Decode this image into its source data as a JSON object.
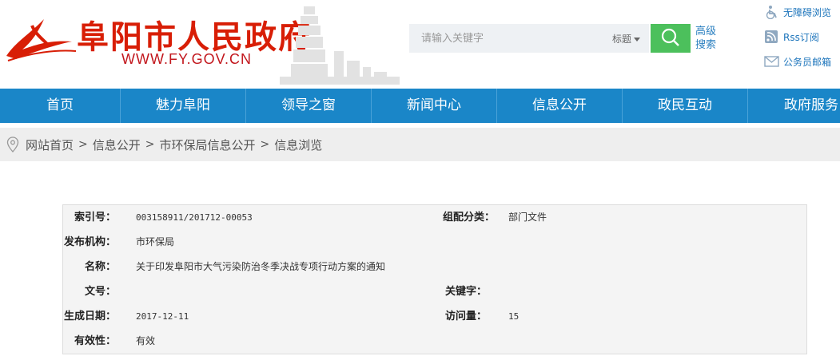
{
  "header": {
    "site_title": "阜阳市人民政府",
    "site_url": "WWW.FY.GOV.CN",
    "search": {
      "placeholder": "请输入关键字",
      "scope_selected": "标题",
      "advanced_label": "高级搜索"
    },
    "quick_links": [
      {
        "label": "无障碍浏览",
        "icon": "accessibility-icon"
      },
      {
        "label": "Rss订阅",
        "icon": "rss-icon"
      },
      {
        "label": "公务员邮箱",
        "icon": "mail-icon"
      }
    ]
  },
  "nav": {
    "items": [
      "首页",
      "魅力阜阳",
      "领导之窗",
      "新闻中心",
      "信息公开",
      "政民互动",
      "政府服务"
    ]
  },
  "breadcrumb": {
    "items": [
      "网站首页",
      "信息公开",
      "市环保局信息公开",
      "信息浏览"
    ],
    "separator": ">"
  },
  "info": {
    "index_label": "索引号：",
    "index_value": "003158911/201712-00053",
    "category_label": "组配分类：",
    "category_value": "部门文件",
    "publisher_label": "发布机构：",
    "publisher_value": "市环保局",
    "name_label": "名称：",
    "name_value": "关于印发阜阳市大气污染防治冬季决战专项行动方案的通知",
    "docno_label": "文号：",
    "docno_value": "",
    "keyword_label": "关键字：",
    "keyword_value": "",
    "date_label": "生成日期：",
    "date_value": "2017-12-11",
    "visits_label": "访问量：",
    "visits_value": "15",
    "validity_label": "有效性：",
    "validity_value": "有效"
  },
  "colors": {
    "brand_red": "#d81e06",
    "nav_blue": "#1a86c8",
    "search_green": "#4cc05c",
    "link_blue": "#1c74bb"
  }
}
